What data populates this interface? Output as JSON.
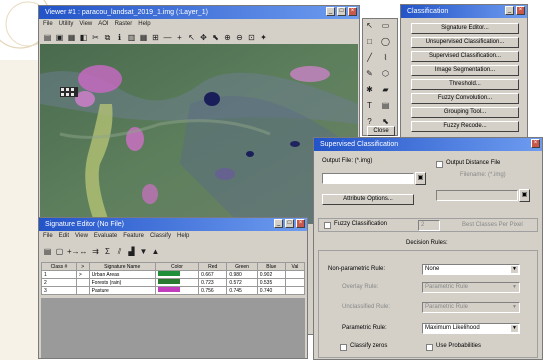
{
  "viewer": {
    "title": "Viewer #1 : paracou_landsat_2019_1.img (:Layer_1)",
    "menu": [
      "File",
      "Utility",
      "View",
      "AOI",
      "Raster",
      "Help"
    ]
  },
  "classification": {
    "title": "Classification",
    "buttons": [
      "Signature Editor...",
      "Unsupervised Classification...",
      "Supervised Classification...",
      "Image Segmentation...",
      "Threshold...",
      "Fuzzy Convolution...",
      "Grouping Tool...",
      "Fuzzy Recode..."
    ]
  },
  "tools": {
    "close_label": "Close"
  },
  "signature_editor": {
    "title": "Signature Editor (No File)",
    "menu": [
      "File",
      "Edit",
      "View",
      "Evaluate",
      "Feature",
      "Classify",
      "Help"
    ],
    "headers": [
      "Class #",
      ">",
      "Signature Name",
      "Color",
      "Red",
      "Green",
      "Blue",
      "Val"
    ],
    "rows": [
      {
        "num": "1",
        "mark": ">",
        "name": "Urban Areas",
        "color": "#1f8f3a",
        "red": "0.667",
        "green": "0.980",
        "blue": "0.902"
      },
      {
        "num": "2",
        "mark": "",
        "name": "Forests (rain)",
        "color": "#2a7a2f",
        "red": "0.723",
        "green": "0.572",
        "blue": "0.535"
      },
      {
        "num": "3",
        "mark": "",
        "name": "Pasture",
        "color": "#c13dbd",
        "red": "0.756",
        "green": "0.745",
        "blue": "0.740"
      }
    ]
  },
  "supervised": {
    "title": "Supervised Classification",
    "output_file_label": "Output File: (*.img)",
    "output_file_value": "",
    "attribute_options": "Attribute Options...",
    "distance_file_label": "Output Distance File",
    "distance_file_filename": "Filename: (*.img)",
    "fuzzy_label": "Fuzzy Classification",
    "fuzzy_value": "2",
    "best_classes_label": "Best Classes Per Pixel",
    "decision_rules": "Decision Rules:",
    "nonparametric_label": "Non-parametric Rule:",
    "nonparametric_value": "None",
    "overlay_label": "Overlay Rule:",
    "overlay_value": "Parametric Rule",
    "unclassified_label": "Unclassified Rule:",
    "unclassified_value": "Parametric Rule",
    "parametric_label": "Parametric Rule:",
    "parametric_value": "Maximum Likelihood",
    "classify_zeros": "Classify zeros",
    "use_probabilities": "Use Probabilities"
  }
}
